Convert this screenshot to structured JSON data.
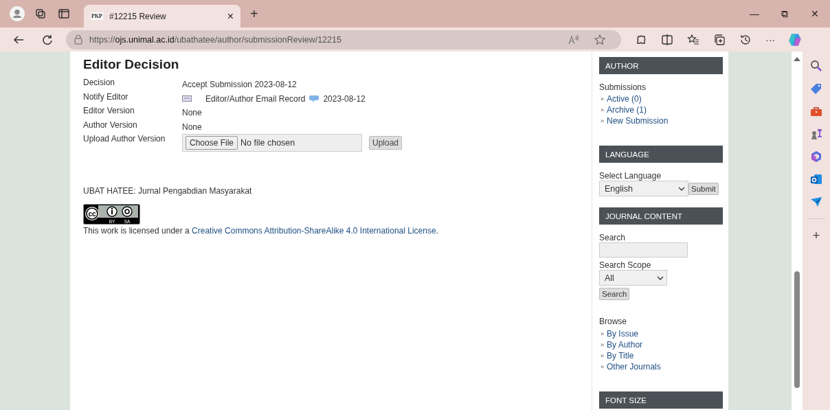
{
  "browser": {
    "tab": {
      "favicon_text": "PKP",
      "title": "#12215 Review",
      "close": "×",
      "selected": true
    },
    "new_tab": "+",
    "window_controls": [
      "—",
      "⧉",
      "✕"
    ],
    "url": "https://**ojs.unimal.ac.id**/ubathatee/author/submissionReview/12215",
    "more": "···"
  },
  "editor_decision": {
    "title": "Editor Decision",
    "rows": [
      {
        "kind": "text",
        "label": "Decision",
        "value": "Accept Submission 2023-08-12"
      },
      {
        "kind": "email",
        "label": "Notify Editor",
        "link": "Editor/Author Email Record",
        "date": "2023-08-12"
      },
      {
        "kind": "text",
        "label": "Editor Version",
        "value": "None"
      },
      {
        "kind": "text",
        "label": "Author Version",
        "value": "None"
      },
      {
        "kind": "file",
        "label": "Upload Author Version",
        "choose": "Choose File",
        "status": "No file chosen",
        "button": "Upload"
      }
    ]
  },
  "footer": {
    "journal": "UBAT HATEE: Jurnal Pengabdian Masyarakat",
    "badge": {
      "top": [
        "cc"
      ],
      "bottom": [
        "BY",
        "SA"
      ]
    },
    "license_before": "This work is licensed under a ",
    "license_link": "Creative Commons Attribution-ShareAlike 4.0 International License",
    "license_after": "."
  },
  "sidebar": [
    {
      "kind": "links",
      "title": "AUTHOR",
      "heading": "Submissions",
      "links": [
        {
          "bullet": "»",
          "label": "Active (0)"
        },
        {
          "bullet": "»",
          "label": "Archive (1)"
        },
        {
          "bullet": "»",
          "label": "New Submission"
        }
      ]
    },
    {
      "kind": "language",
      "title": "LANGUAGE",
      "label": "Select Language",
      "value": "English",
      "button": "Submit"
    },
    {
      "kind": "search",
      "title": "JOURNAL CONTENT",
      "search_label": "Search",
      "scope_label": "Search Scope",
      "scope": "All",
      "button": "Search",
      "heading": "Browse",
      "links": [
        {
          "bullet": "»",
          "label": "By Issue"
        },
        {
          "bullet": "»",
          "label": "By Author"
        },
        {
          "bullet": "»",
          "label": "By Title"
        },
        {
          "bullet": "»",
          "label": "Other Journals"
        }
      ]
    },
    {
      "kind": "empty",
      "title": "FONT SIZE"
    }
  ],
  "edge_sidebar": {
    "add": "+"
  }
}
